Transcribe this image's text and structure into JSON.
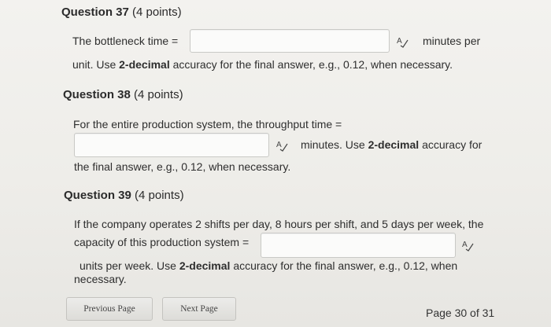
{
  "q37": {
    "number": "Question 37",
    "points": "(4 points)",
    "text1": "The bottleneck time =",
    "text2": "minutes per",
    "line2": [
      "unit. Use ",
      "2-decimal",
      " accuracy for the final answer, e.g., 0.12, when necessary."
    ]
  },
  "q38": {
    "number": "Question 38",
    "points": "(4 points)",
    "text1": "For the entire production system, the throughput time =",
    "line2": [
      "minutes. Use ",
      "2-decimal",
      " accuracy for"
    ],
    "line3": "the final answer, e.g., 0.12, when necessary."
  },
  "q39": {
    "number": "Question 39",
    "points": "(4 points)",
    "line1": "If the company operates 2 shifts per day, 8 hours per shift, and 5 days per week, the",
    "line2": "capacity of this production system =",
    "line3": [
      "units per week. Use ",
      "2-decimal",
      " accuracy for the final answer, e.g., 0.12, when"
    ],
    "line4": "necessary."
  },
  "nav": {
    "previous": "Previous Page",
    "next": "Next Page",
    "page_info": "Page 30 of 31"
  },
  "icons": {
    "spellcheck": "spellcheck-icon"
  }
}
